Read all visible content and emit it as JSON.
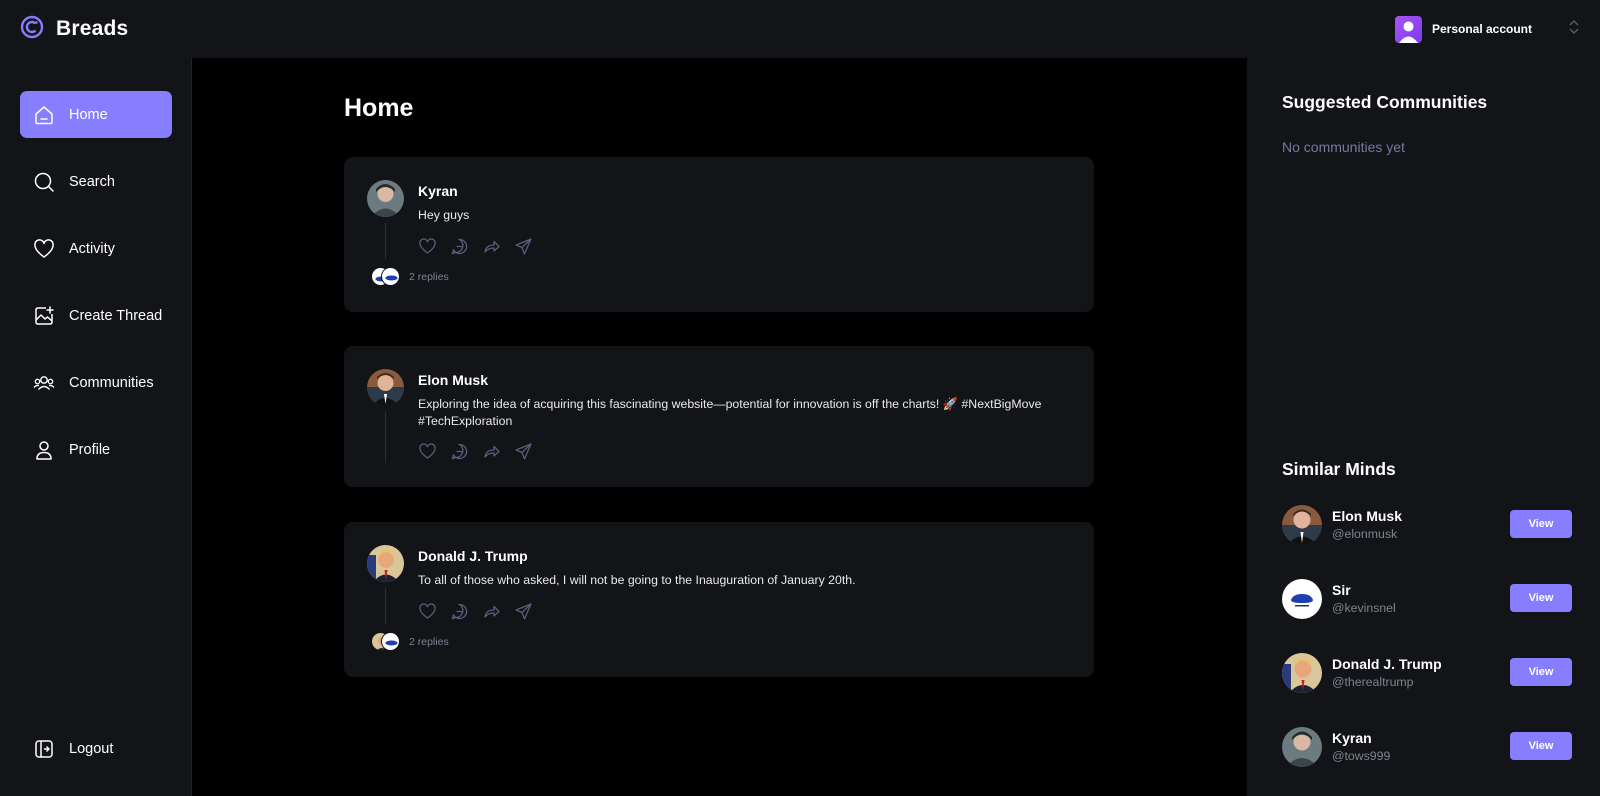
{
  "brand": {
    "name": "Breads",
    "accent": "#877eff"
  },
  "account": {
    "label": "Personal account"
  },
  "nav": {
    "home": "Home",
    "search": "Search",
    "activity": "Activity",
    "create_thread": "Create Thread",
    "communities": "Communities",
    "profile": "Profile",
    "logout": "Logout"
  },
  "main": {
    "title": "Home",
    "threads": [
      {
        "author": "Kyran",
        "content": "Hey guys",
        "replies": "2 replies"
      },
      {
        "author": "Elon Musk",
        "content": "Exploring the idea of acquiring this fascinating website—potential for innovation is off the charts! 🚀 #NextBigMove #TechExploration"
      },
      {
        "author": "Donald J. Trump",
        "content": "To all of those who asked, I will not be going to the Inauguration of January 20th.",
        "replies": "2 replies"
      }
    ]
  },
  "rightbar": {
    "communities_title": "Suggested Communities",
    "communities_empty": "No communities yet",
    "minds_title": "Similar Minds",
    "view_label": "View",
    "minds": [
      {
        "name": "Elon Musk",
        "handle": "@elonmusk"
      },
      {
        "name": "Sir",
        "handle": "@kevinsnel"
      },
      {
        "name": "Donald J. Trump",
        "handle": "@therealtrump"
      },
      {
        "name": "Kyran",
        "handle": "@tows999"
      }
    ]
  }
}
